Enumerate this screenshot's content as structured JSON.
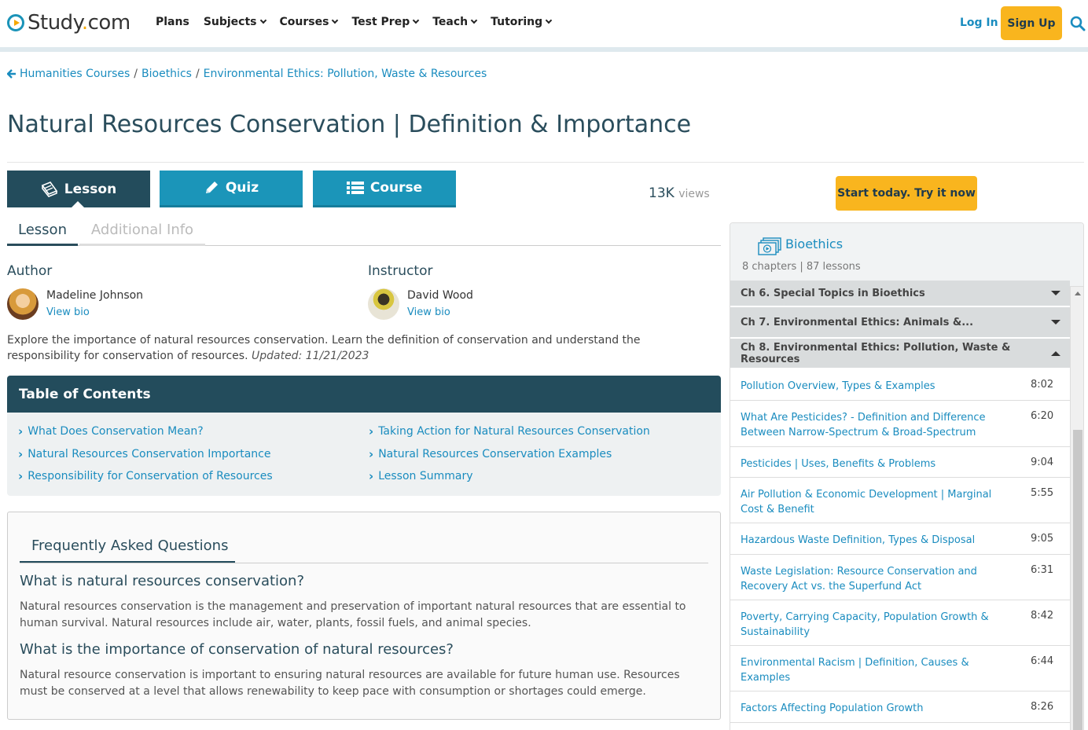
{
  "header": {
    "logo": "Study.com",
    "nav": [
      {
        "label": "Plans",
        "dropdown": false
      },
      {
        "label": "Subjects",
        "dropdown": true
      },
      {
        "label": "Courses",
        "dropdown": true
      },
      {
        "label": "Test Prep",
        "dropdown": true
      },
      {
        "label": "Teach",
        "dropdown": true
      },
      {
        "label": "Tutoring",
        "dropdown": true
      }
    ],
    "login": "Log In",
    "signup": "Sign Up"
  },
  "breadcrumb": {
    "items": [
      "Humanities Courses",
      "Bioethics",
      "Environmental Ethics: Pollution, Waste & Resources"
    ]
  },
  "page_title": "Natural Resources Conservation | Definition & Importance",
  "tabs": {
    "lesson": "Lesson",
    "quiz": "Quiz",
    "course": "Course"
  },
  "views": {
    "count": "13K",
    "label": "views"
  },
  "cta": "Start today. Try it now",
  "subtabs": {
    "lesson": "Lesson",
    "info": "Additional Info"
  },
  "author": {
    "heading": "Author",
    "name": "Madeline Johnson",
    "bio": "View bio"
  },
  "instructor": {
    "heading": "Instructor",
    "name": "David Wood",
    "bio": "View bio"
  },
  "description": {
    "text": "Explore the importance of natural resources conservation. Learn the definition of conservation and understand the responsibility for conservation of resources.",
    "updated": "Updated: 11/21/2023"
  },
  "toc": {
    "title": "Table of Contents",
    "items": [
      "What Does Conservation Mean?",
      "Natural Resources Conservation Importance",
      "Responsibility for Conservation of Resources",
      "Taking Action for Natural Resources Conservation",
      "Natural Resources Conservation Examples",
      "Lesson Summary"
    ]
  },
  "faq": {
    "title": "Frequently Asked Questions",
    "items": [
      {
        "q": "What is natural resources conservation?",
        "a": "Natural resources conservation is the management and preservation of important natural resources that are essential to human survival. Natural resources include air, water, plants, fossil fuels, and animal species."
      },
      {
        "q": "What is the importance of conservation of natural resources?",
        "a": "Natural resource conservation is important to ensuring natural resources are available for future human use. Resources must be conserved at a level that allows renewability to keep pace with consumption or shortages could emerge."
      }
    ]
  },
  "sidebar": {
    "course": "Bioethics",
    "meta": "8 chapters | 87 lessons",
    "chapters": [
      {
        "label": "Ch 6. Special Topics in Bioethics",
        "expanded": false
      },
      {
        "label": "Ch 7. Environmental Ethics: Animals &...",
        "expanded": false
      },
      {
        "label": "Ch 8. Environmental Ethics: Pollution, Waste & Resources",
        "expanded": true
      }
    ],
    "lessons": [
      {
        "title": "Pollution Overview, Types & Examples",
        "time": "8:02"
      },
      {
        "title": "What Are Pesticides? - Definition and Difference Between Narrow-Spectrum & Broad-Spectrum",
        "time": "6:20"
      },
      {
        "title": "Pesticides | Uses, Benefits & Problems",
        "time": "9:04"
      },
      {
        "title": "Air Pollution & Economic Development | Marginal Cost & Benefit",
        "time": "5:55"
      },
      {
        "title": "Hazardous Waste Definition, Types & Disposal",
        "time": "9:05"
      },
      {
        "title": "Waste Legislation: Resource Conservation and Recovery Act vs. the Superfund Act",
        "time": "6:31"
      },
      {
        "title": "Poverty, Carrying Capacity, Population Growth & Sustainability",
        "time": "8:42"
      },
      {
        "title": "Environmental Racism | Definition, Causes & Examples",
        "time": "6:44"
      },
      {
        "title": "Factors Affecting Population Growth",
        "time": "8:26"
      }
    ]
  },
  "colors": {
    "brand_dark": "#234c5c",
    "brand_blue": "#1b95b9",
    "link": "#1a8cbf",
    "cta": "#f9b51e"
  }
}
